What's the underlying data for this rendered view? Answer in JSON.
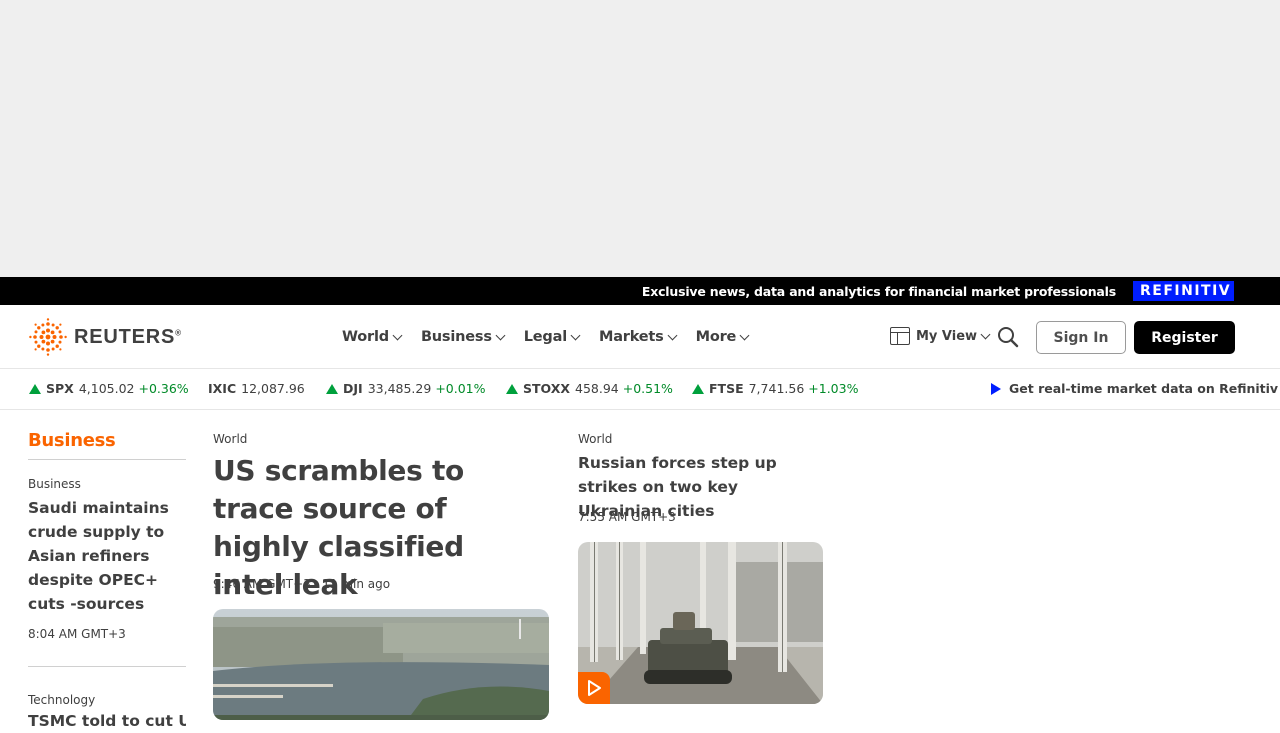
{
  "promo": {
    "text": "Exclusive news, data and analytics for financial market professionals",
    "brand": "REFINITIV"
  },
  "header": {
    "logo_text": "REUTERS",
    "nav": [
      "World",
      "Business",
      "Legal",
      "Markets",
      "More"
    ],
    "myview_label": "My View",
    "signin_label": "Sign In",
    "register_label": "Register"
  },
  "ticker": {
    "items": [
      {
        "symbol": "SPX",
        "value": "4,105.02",
        "change": "+0.36%",
        "direction": "up"
      },
      {
        "symbol": "IXIC",
        "value": "12,087.96",
        "change": "",
        "direction": "none"
      },
      {
        "symbol": "DJI",
        "value": "33,485.29",
        "change": "+0.01%",
        "direction": "up"
      },
      {
        "symbol": "STOXX",
        "value": "458.94",
        "change": "+0.51%",
        "direction": "up"
      },
      {
        "symbol": "FTSE",
        "value": "7,741.56",
        "change": "+1.03%",
        "direction": "up"
      }
    ],
    "refinitiv_link": "Get real-time market data on Refinitiv"
  },
  "section": {
    "title": "Business"
  },
  "left_column": {
    "story1": {
      "kicker": "Business",
      "headline": "Saudi maintains crude supply to Asian refiners despite OPEC+ cuts -sources",
      "time": "8:04 AM GMT+3"
    },
    "story2": {
      "kicker": "Technology",
      "headline": "TSMC told to cut US"
    }
  },
  "lead_story": {
    "kicker": "World",
    "headline": "US scrambles to trace source of highly classified intel leak",
    "time": "9:46 AM GMT+3 · 11 min ago"
  },
  "right_story": {
    "kicker": "World",
    "headline": "Russian forces step up strikes on two key Ukrainian cities",
    "time": "7:55 AM GMT+3"
  },
  "colors": {
    "accent": "#fa6400",
    "ticker_up": "#00a03c",
    "refinitiv_blue": "#001eff"
  }
}
